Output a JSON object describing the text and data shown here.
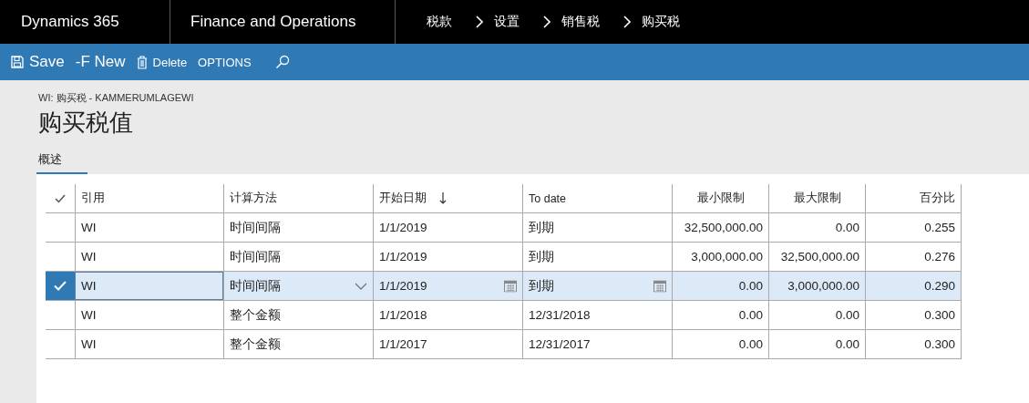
{
  "header": {
    "product": "Dynamics 365",
    "module": "Finance and Operations",
    "breadcrumb": [
      "税款",
      "设置",
      "销售税",
      "购买税"
    ]
  },
  "toolbar": {
    "save": "Save",
    "new": "-F New",
    "delete": "Delete",
    "options": "OPTIONS"
  },
  "page": {
    "caption": "WI: 购买税 - KAMMERUMLAGEWI",
    "title": "购买税值"
  },
  "tabs": [
    {
      "label": "概述",
      "selected": true
    }
  ],
  "table": {
    "columns": [
      {
        "label": "引用",
        "kind": "text",
        "sorted": false
      },
      {
        "label": "计算方法",
        "kind": "dropdown",
        "sorted": false
      },
      {
        "label": "开始日期",
        "kind": "date",
        "sorted": true
      },
      {
        "label": "To date",
        "kind": "date",
        "sorted": false
      },
      {
        "label": "最小限制",
        "kind": "number",
        "sorted": false
      },
      {
        "label": "最大限制",
        "kind": "number",
        "sorted": false
      },
      {
        "label": "百分比",
        "kind": "number",
        "sorted": false
      }
    ],
    "rows": [
      {
        "selected": false,
        "cells": [
          "WI",
          "时间间隔",
          "1/1/2019",
          "到期",
          "32,500,000.00",
          "0.00",
          "0.255"
        ]
      },
      {
        "selected": false,
        "cells": [
          "WI",
          "时间间隔",
          "1/1/2019",
          "到期",
          "3,000,000.00",
          "32,500,000.00",
          "0.276"
        ]
      },
      {
        "selected": true,
        "cells": [
          "WI",
          "时间间隔",
          "1/1/2019",
          "到期",
          "0.00",
          "3,000,000.00",
          "0.290"
        ]
      },
      {
        "selected": false,
        "cells": [
          "WI",
          "整个金额",
          "1/1/2018",
          "12/31/2018",
          "0.00",
          "0.00",
          "0.300"
        ]
      },
      {
        "selected": false,
        "cells": [
          "WI",
          "整个金额",
          "1/1/2017",
          "12/31/2017",
          "0.00",
          "0.00",
          "0.300"
        ]
      }
    ]
  }
}
